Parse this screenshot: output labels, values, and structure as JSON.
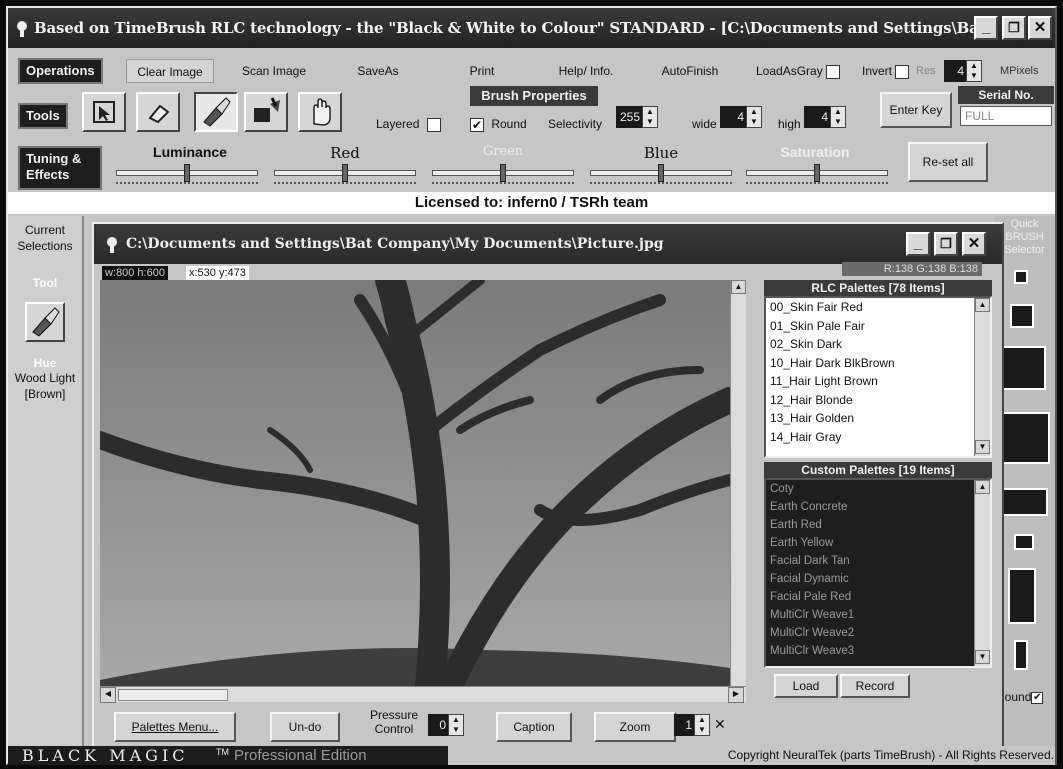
{
  "window": {
    "title": "Based on TimeBrush RLC technology - the \"Black & White to Colour\" STANDARD - [C:\\Documents and Settings\\Ba...",
    "min": "_",
    "max": "❐",
    "close": "✕"
  },
  "menu": {
    "operations": "Operations",
    "clear_image": "Clear Image",
    "scan_image": "Scan Image",
    "save_as": "SaveAs",
    "print": "Print",
    "help_info": "Help/ Info.",
    "auto_finish": "AutoFinish",
    "load_as_gray": "LoadAsGray",
    "invert": "Invert",
    "res": "Res",
    "res_value": "4",
    "mpixels": "MPixels"
  },
  "tools": {
    "label": "Tools",
    "layered": "Layered",
    "brush_props_title": "Brush Properties",
    "round": "Round",
    "selectivity": "Selectivity",
    "selectivity_value": "255",
    "wide": "wide",
    "wide_value": "4",
    "high": "high",
    "high_value": "4",
    "enter_key": "Enter Key",
    "serial_title": "Serial No.",
    "serial_value": "FULL"
  },
  "tuning": {
    "label": "Tuning & Effects",
    "luminance": "Luminance",
    "red": "Red",
    "green": "Green",
    "blue": "Blue",
    "saturation": "Saturation",
    "reset": "Re-set all"
  },
  "license": "Licensed to: infern0 / TSRh team",
  "left_panel": {
    "current_selections": "Current Selections",
    "tool": "Tool",
    "hue": "Hue",
    "hue_value": "Wood Light [Brown]"
  },
  "right_panel": {
    "title": "Quick BRUSH Selector",
    "round": "Round"
  },
  "image_window": {
    "title": "C:\\Documents and Settings\\Bat Company\\My Documents\\Picture.jpg",
    "dims": "w:800 h:600",
    "coords": "x:530 y:473",
    "rgb": "R:138 G:138 B:138"
  },
  "rlc": {
    "header": "RLC Palettes [78 Items]",
    "items": [
      "00_Skin Fair Red",
      "01_Skin Pale Fair",
      "02_Skin Dark",
      "10_Hair Dark BlkBrown",
      "11_Hair Light Brown",
      "12_Hair Blonde",
      "13_Hair Golden",
      "14_Hair Gray"
    ]
  },
  "custom": {
    "header": "Custom Palettes [19 Items]",
    "items": [
      "Coty",
      "Earth Concrete",
      "Earth Red",
      "Earth Yellow",
      "Facial Dark Tan",
      "Facial Dynamic",
      "Facial Pale Red",
      "MultiClr Weave1",
      "MultiClr Weave2",
      "MultiClr Weave3"
    ],
    "load": "Load",
    "record": "Record"
  },
  "bottom": {
    "palettes_menu": "Palettes Menu...",
    "undo": "Un-do",
    "pressure_control": "Pressure Control",
    "pressure_value": "0",
    "caption": "Caption",
    "zoom": "Zoom",
    "zoom_value": "1",
    "zoom_x": "✕"
  },
  "footer": {
    "brand": "BLACK MAGIC",
    "tm": "TM",
    "edition": "Professional Edition",
    "copyright": "Copyright NeuralTek (parts TimeBrush) - All Rights Reserved."
  }
}
